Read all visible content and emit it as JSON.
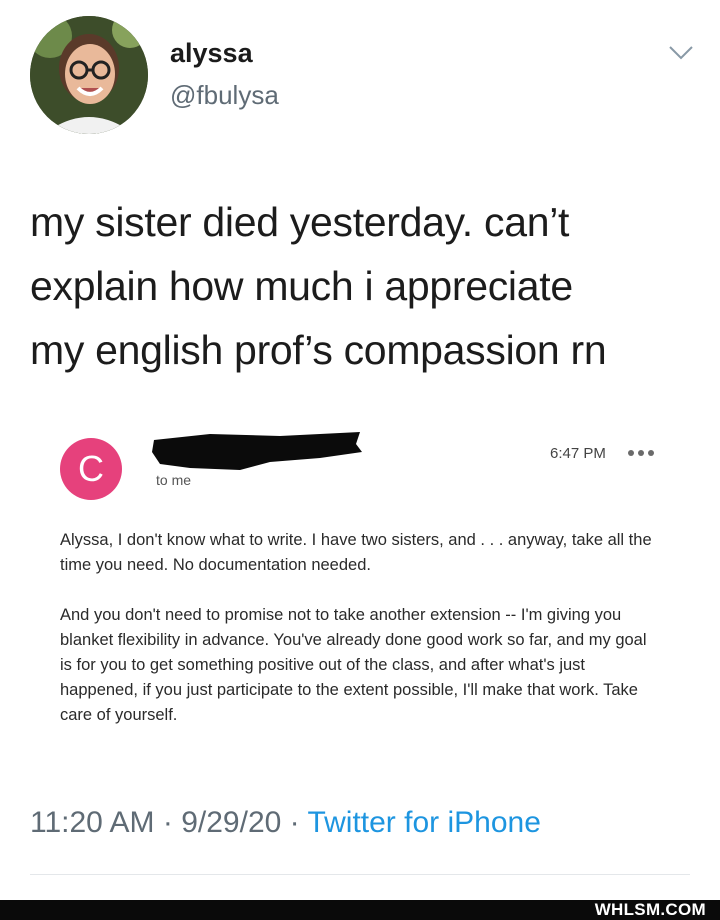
{
  "tweet": {
    "author": {
      "display_name": "alyssa",
      "handle": "@fbulysa"
    },
    "text_lines": [
      "my sister died yesterday. can’t",
      "explain how much i appreciate",
      "my english prof’s compassion rn"
    ],
    "timestamp_time": "11:20 AM",
    "timestamp_date": "9/29/20",
    "separator": "·",
    "source": "Twitter for iPhone"
  },
  "email": {
    "sender_initial": "C",
    "recipient": "to me",
    "time": "6:47 PM",
    "paragraphs": [
      "Alyssa, I don't know what to write. I have two sisters, and . . . anyway, take all the time you need. No documentation needed.",
      "And you don't need to promise not to take another extension -- I'm giving you blanket flexibility in advance. You've already done good work so far, and my goal is for you to get something positive out of the class, and after what's just happened, if you just participate to the extent possible, I'll make that work. Take care of yourself."
    ]
  },
  "watermark": "WHLSM.COM",
  "icons": {
    "menu": "chevron-down-icon",
    "email_more": "more-dots-icon"
  },
  "colors": {
    "sender_avatar": "#e6417c",
    "link": "#1d95e0",
    "muted": "#5f6b75"
  }
}
